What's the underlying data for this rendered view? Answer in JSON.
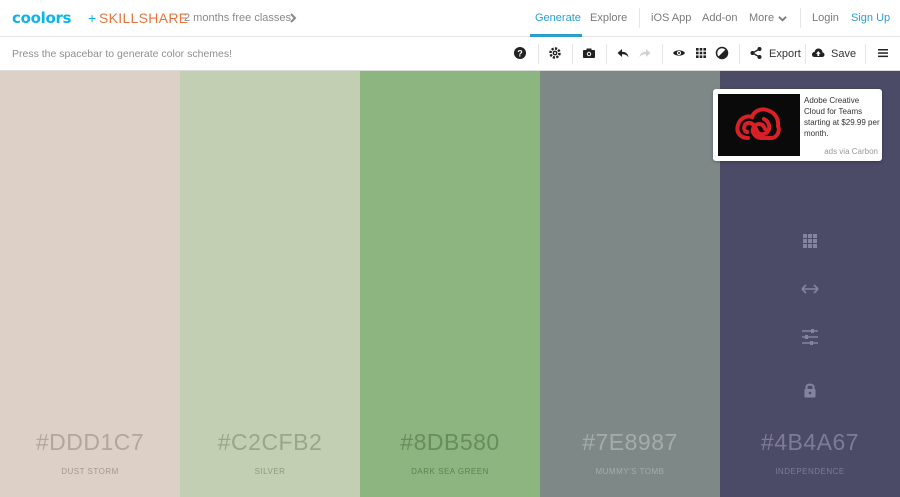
{
  "nav": {
    "logo": "coolors",
    "plus": "+",
    "partner": "SKILLSHARE",
    "promo": "2 months free classes",
    "links": {
      "generate": "Generate",
      "explore": "Explore",
      "ios": "iOS App",
      "addon": "Add-on",
      "more": "More",
      "login": "Login",
      "signup": "Sign Up"
    },
    "accent": "#2ba0cf"
  },
  "toolbar": {
    "hint": "Press the spacebar to generate color schemes!",
    "export_label": "Export",
    "save_label": "Save",
    "icons": [
      "help-icon",
      "settings-icon",
      "camera-icon",
      "undo-icon",
      "redo-icon",
      "eye-icon",
      "grid-icon",
      "contrast-icon",
      "share-icon",
      "cloud-upload-icon",
      "menu-icon"
    ]
  },
  "palette": {
    "colors": [
      {
        "hex": "#DDD1C7",
        "name": "DUST STORM",
        "bg": "#DDD1C7",
        "hex_color": "#b3a69c",
        "name_color": "#a4988e"
      },
      {
        "hex": "#C2CFB2",
        "name": "SILVER",
        "bg": "#C2CFB2",
        "hex_color": "#9aa68b",
        "name_color": "#8e9a80"
      },
      {
        "hex": "#8DB580",
        "name": "DARK SEA GREEN",
        "bg": "#8DB580",
        "hex_color": "#698c5d",
        "name_color": "#5f8154"
      },
      {
        "hex": "#7E8987",
        "name": "MUMMY'S TOMB",
        "bg": "#7E8987",
        "hex_color": "#a3acaa",
        "name_color": "#a3acaa"
      },
      {
        "hex": "#4B4A67",
        "name": "INDEPENDENCE",
        "bg": "#4B4A67",
        "hex_color": "#7d7c96",
        "name_color": "#7d7c96"
      }
    ],
    "hover_tools": [
      "grid-icon",
      "drag-arrows-icon",
      "adjust-sliders-icon",
      "lock-icon"
    ]
  },
  "ad": {
    "text": "Adobe Creative Cloud for Teams starting at $29.99 per month.",
    "via": "ads via Carbon",
    "logo_color": "#da1f26"
  }
}
